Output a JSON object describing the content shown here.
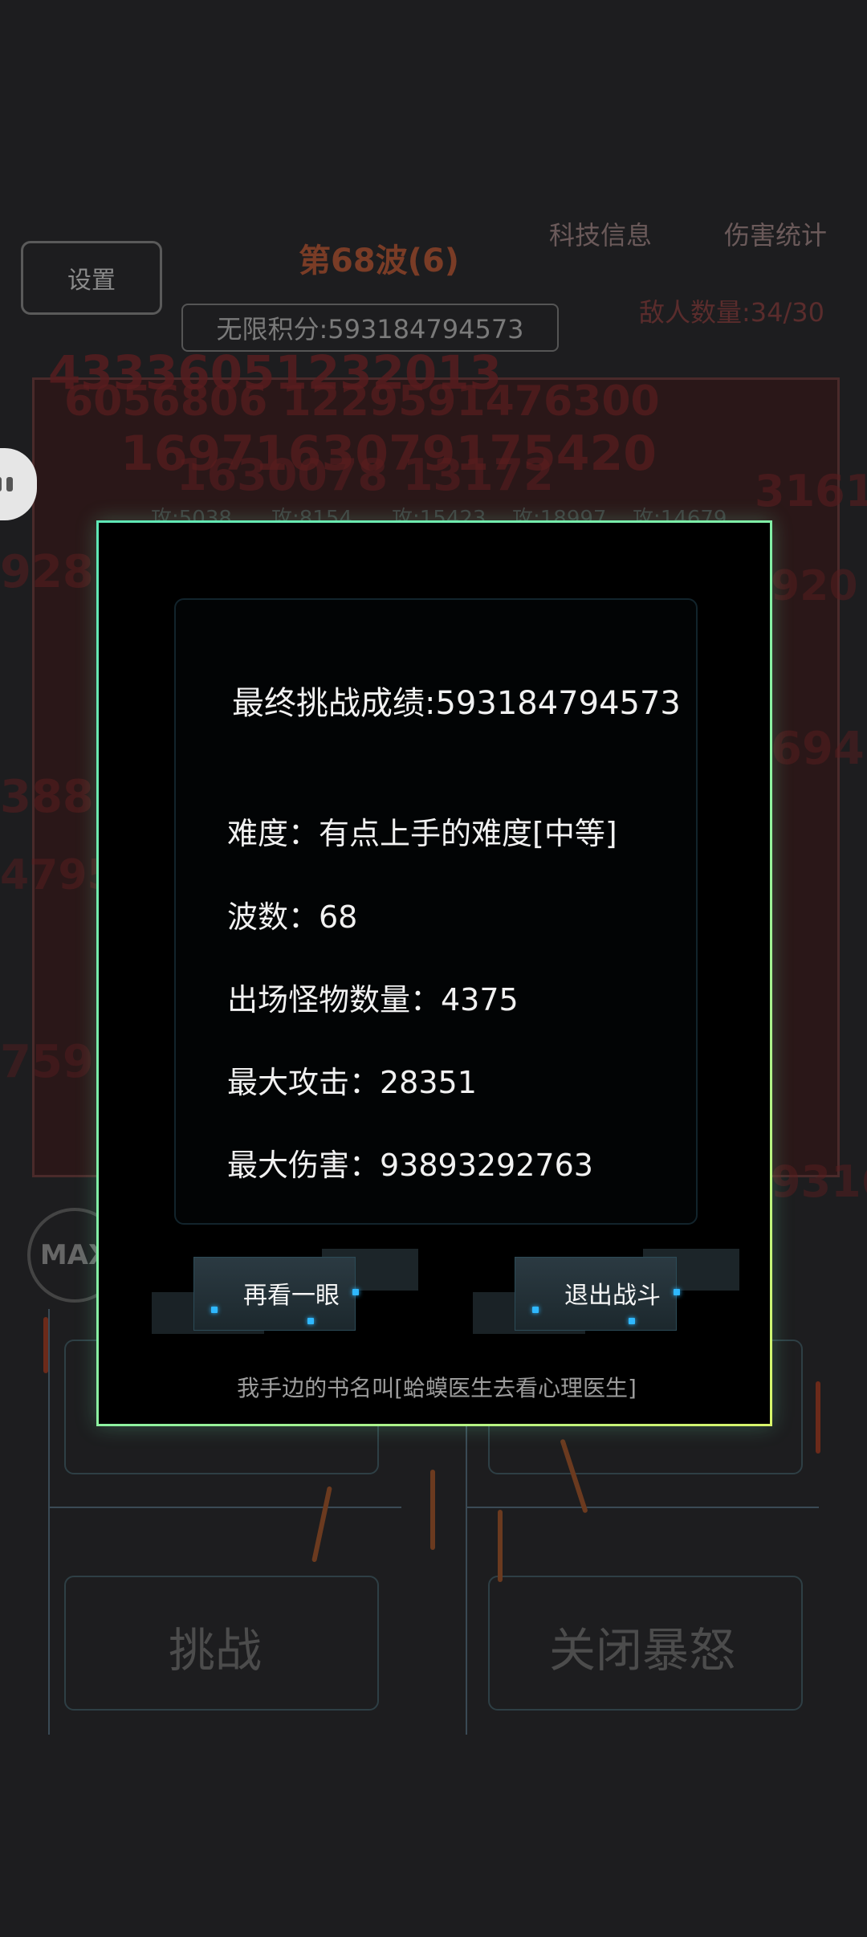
{
  "background": {
    "settings_label": "设置",
    "wave_title": "第68波(6)",
    "tech_info_label": "科技信息",
    "damage_stats_label": "伤害统计",
    "infinite_score": "无限积分:593184794573",
    "enemy_count": "敌人数量:34/30",
    "skill_attacks": [
      "攻:5038",
      "攻:8154",
      "攻:15423",
      "攻:18997",
      "攻:14679"
    ],
    "max_badge": "MAX",
    "challenge_label": "挑战",
    "close_rage_label": "关闭暴怒"
  },
  "modal": {
    "final_score": "最终挑战成绩:593184794573",
    "stats": [
      "难度：有点上手的难度[中等]",
      "波数：68",
      "出场怪物数量：4375",
      "最大攻击：28351",
      "最大伤害：93893292763"
    ],
    "look_again_label": "再看一眼",
    "exit_battle_label": "退出战斗",
    "footer_text": "我手边的书名叫[蛤蟆医生去看心理医生]"
  },
  "colors": {
    "modal_border_start": "#5ee7b6",
    "modal_border_end": "#d9f56a",
    "button_dot": "#2fb8ff",
    "background": "#1d1d1f"
  }
}
